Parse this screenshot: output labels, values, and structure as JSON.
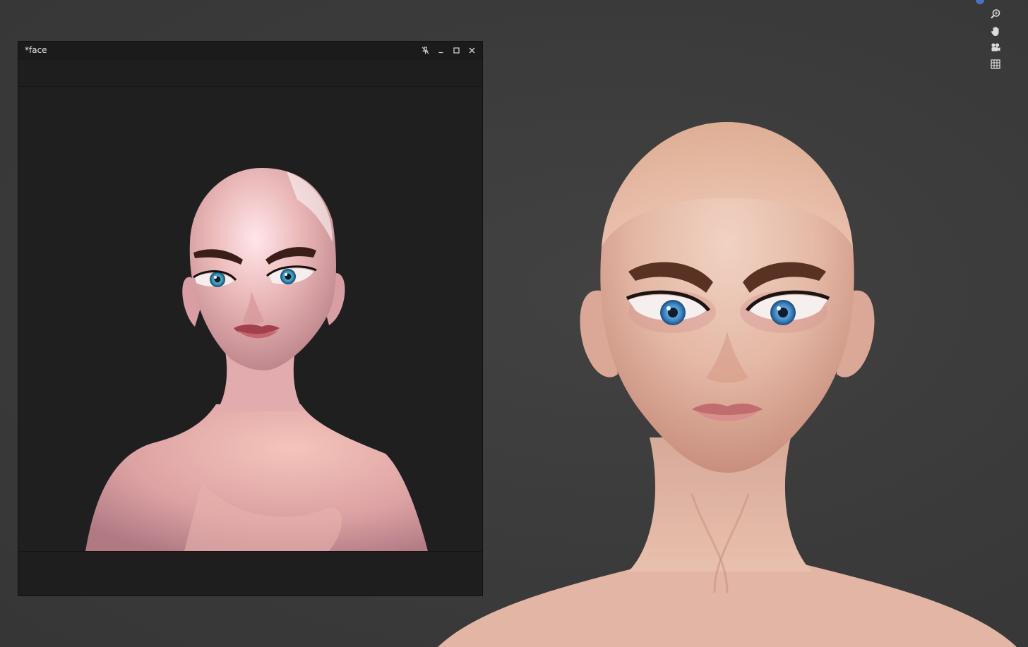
{
  "reference_window": {
    "title": "*face",
    "controls": {
      "pin_icon": "pin-off-icon",
      "minimize_icon": "minimize-icon",
      "maximize_icon": "maximize-icon",
      "close_icon": "close-icon"
    }
  },
  "navigation_gizmo": {
    "items": [
      "zoom-icon",
      "hand-pan-icon",
      "camera-icon",
      "grid-icon"
    ],
    "accent_color": "#4a72c4"
  },
  "colors": {
    "viewport_bg": "#3b3b3b",
    "window_bg": "#1e1e1e",
    "title_text": "#e6e6e6"
  }
}
